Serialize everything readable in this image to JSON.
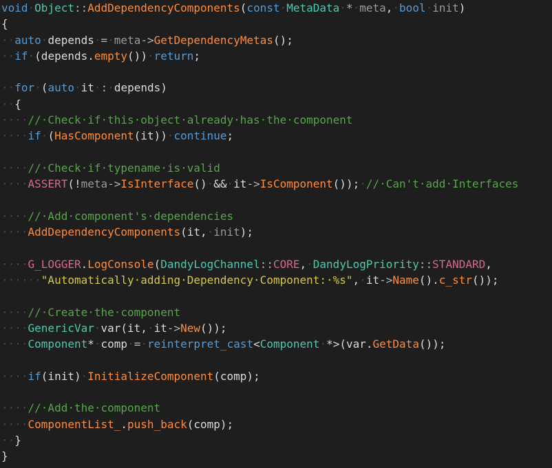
{
  "editor": {
    "language": "C++",
    "colors": {
      "background": "#1e1e1e",
      "keyword": "#569cd6",
      "type": "#4ec9b0",
      "function": "#ff8c3a",
      "macro": "#d46a8c",
      "comment": "#57a64a",
      "string": "#d6c94a",
      "identifier": "#dcdcdc",
      "parameter": "#9a9a9a",
      "whitespace_marker": "#4a4a4a"
    },
    "lines": [
      [
        [
          "kw",
          "void"
        ],
        [
          "ws",
          "·"
        ],
        [
          "type",
          "Object"
        ],
        [
          "op",
          "::"
        ],
        [
          "fn",
          "AddDependencyComponents"
        ],
        [
          "id",
          "("
        ],
        [
          "kw",
          "const"
        ],
        [
          "ws",
          "·"
        ],
        [
          "type",
          "MetaData"
        ],
        [
          "ws",
          "·"
        ],
        [
          "op",
          "*"
        ],
        [
          "ws",
          "·"
        ],
        [
          "var",
          "meta"
        ],
        [
          "id",
          ","
        ],
        [
          "ws",
          "·"
        ],
        [
          "kw",
          "bool"
        ],
        [
          "ws",
          "·"
        ],
        [
          "var",
          "init"
        ],
        [
          "id",
          ")"
        ]
      ],
      [
        [
          "id",
          "{"
        ]
      ],
      [
        [
          "ws",
          "··"
        ],
        [
          "kw",
          "auto"
        ],
        [
          "ws",
          "·"
        ],
        [
          "id",
          "depends"
        ],
        [
          "ws",
          "·"
        ],
        [
          "op",
          "="
        ],
        [
          "ws",
          "·"
        ],
        [
          "var",
          "meta"
        ],
        [
          "op",
          "->"
        ],
        [
          "fn",
          "GetDependencyMetas"
        ],
        [
          "id",
          "();"
        ]
      ],
      [
        [
          "ws",
          "··"
        ],
        [
          "kw",
          "if"
        ],
        [
          "ws",
          "·"
        ],
        [
          "id",
          "(depends."
        ],
        [
          "fn",
          "empty"
        ],
        [
          "id",
          "())"
        ],
        [
          "ws",
          "·"
        ],
        [
          "kw",
          "return"
        ],
        [
          "id",
          ";"
        ]
      ],
      [],
      [
        [
          "ws",
          "··"
        ],
        [
          "kw",
          "for"
        ],
        [
          "ws",
          "·"
        ],
        [
          "id",
          "("
        ],
        [
          "kw",
          "auto"
        ],
        [
          "ws",
          "·"
        ],
        [
          "id",
          "it"
        ],
        [
          "ws",
          "·"
        ],
        [
          "op",
          ":"
        ],
        [
          "ws",
          "·"
        ],
        [
          "id",
          "depends)"
        ]
      ],
      [
        [
          "ws",
          "··"
        ],
        [
          "id",
          "{"
        ]
      ],
      [
        [
          "ws",
          "····"
        ],
        [
          "com",
          "//·Check·if·this·object·already·has·the·component"
        ]
      ],
      [
        [
          "ws",
          "····"
        ],
        [
          "kw",
          "if"
        ],
        [
          "ws",
          "·"
        ],
        [
          "id",
          "("
        ],
        [
          "fn",
          "HasComponent"
        ],
        [
          "id",
          "(it))"
        ],
        [
          "ws",
          "·"
        ],
        [
          "kw",
          "continue"
        ],
        [
          "id",
          ";"
        ]
      ],
      [],
      [
        [
          "ws",
          "····"
        ],
        [
          "com",
          "//·Check·if·typename·is·valid"
        ]
      ],
      [
        [
          "ws",
          "····"
        ],
        [
          "mac",
          "ASSERT"
        ],
        [
          "id",
          "(!"
        ],
        [
          "var",
          "meta"
        ],
        [
          "op",
          "->"
        ],
        [
          "fn",
          "IsInterface"
        ],
        [
          "id",
          "()"
        ],
        [
          "ws",
          "·"
        ],
        [
          "id",
          "&&"
        ],
        [
          "ws",
          "·"
        ],
        [
          "id",
          "it"
        ],
        [
          "op",
          "->"
        ],
        [
          "fn",
          "IsComponent"
        ],
        [
          "id",
          "());"
        ],
        [
          "ws",
          "·"
        ],
        [
          "com",
          "//·Can't·add·Interfaces"
        ]
      ],
      [],
      [
        [
          "ws",
          "····"
        ],
        [
          "com",
          "//·Add·component's·dependencies"
        ]
      ],
      [
        [
          "ws",
          "····"
        ],
        [
          "fn",
          "AddDependencyComponents"
        ],
        [
          "id",
          "(it,"
        ],
        [
          "ws",
          "·"
        ],
        [
          "var",
          "init"
        ],
        [
          "id",
          ");"
        ]
      ],
      [],
      [
        [
          "ws",
          "····"
        ],
        [
          "mac",
          "G_LOGGER"
        ],
        [
          "id",
          "."
        ],
        [
          "fn",
          "LogConsole"
        ],
        [
          "id",
          "("
        ],
        [
          "type",
          "DandyLogChannel"
        ],
        [
          "op",
          "::"
        ],
        [
          "mac",
          "CORE"
        ],
        [
          "id",
          ","
        ],
        [
          "ws",
          "·"
        ],
        [
          "type",
          "DandyLogPriority"
        ],
        [
          "op",
          "::"
        ],
        [
          "mac",
          "STANDARD"
        ],
        [
          "id",
          ","
        ]
      ],
      [
        [
          "ws",
          "······"
        ],
        [
          "str",
          "\"Automatically·adding·Dependency·Component:·%s\""
        ],
        [
          "id",
          ","
        ],
        [
          "ws",
          "·"
        ],
        [
          "id",
          "it"
        ],
        [
          "op",
          "->"
        ],
        [
          "fn",
          "Name"
        ],
        [
          "id",
          "()."
        ],
        [
          "fn",
          "c_str"
        ],
        [
          "id",
          "());"
        ]
      ],
      [],
      [
        [
          "ws",
          "····"
        ],
        [
          "com",
          "//·Create·the·component"
        ]
      ],
      [
        [
          "ws",
          "····"
        ],
        [
          "type",
          "GenericVar"
        ],
        [
          "ws",
          "·"
        ],
        [
          "id",
          "var(it,"
        ],
        [
          "ws",
          "·"
        ],
        [
          "id",
          "it"
        ],
        [
          "op",
          "->"
        ],
        [
          "fn",
          "New"
        ],
        [
          "id",
          "());"
        ]
      ],
      [
        [
          "ws",
          "····"
        ],
        [
          "type",
          "Component"
        ],
        [
          "id",
          "*"
        ],
        [
          "ws",
          "·"
        ],
        [
          "id",
          "comp"
        ],
        [
          "ws",
          "·"
        ],
        [
          "op",
          "="
        ],
        [
          "ws",
          "·"
        ],
        [
          "kw",
          "reinterpret_cast"
        ],
        [
          "id",
          "<"
        ],
        [
          "type",
          "Component"
        ],
        [
          "ws",
          "·"
        ],
        [
          "id",
          "*>(var."
        ],
        [
          "fn",
          "GetData"
        ],
        [
          "id",
          "());"
        ]
      ],
      [],
      [
        [
          "ws",
          "····"
        ],
        [
          "kw",
          "if"
        ],
        [
          "id",
          "(init)"
        ],
        [
          "ws",
          "·"
        ],
        [
          "fn",
          "InitializeComponent"
        ],
        [
          "id",
          "(comp);"
        ]
      ],
      [],
      [
        [
          "ws",
          "····"
        ],
        [
          "com",
          "//·Add·the·component"
        ]
      ],
      [
        [
          "ws",
          "····"
        ],
        [
          "fn",
          "ComponentList_"
        ],
        [
          "id",
          "."
        ],
        [
          "fn",
          "push_back"
        ],
        [
          "id",
          "(comp);"
        ]
      ],
      [
        [
          "ws",
          "··"
        ],
        [
          "id",
          "}"
        ]
      ],
      [
        [
          "id",
          "}"
        ]
      ]
    ]
  }
}
